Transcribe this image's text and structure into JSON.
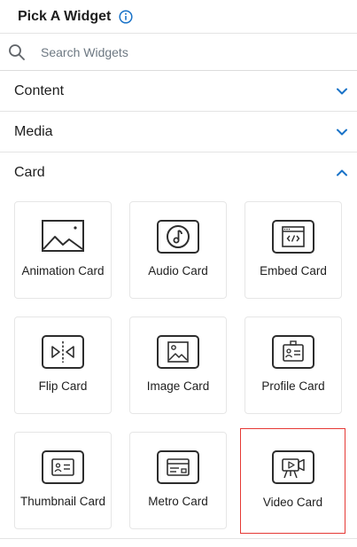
{
  "header": {
    "title": "Pick A Widget",
    "info_icon": "info-icon"
  },
  "search": {
    "placeholder": "Search Widgets",
    "value": "",
    "icon": "search-icon"
  },
  "sections": [
    {
      "label": "Content",
      "expanded": false
    },
    {
      "label": "Media",
      "expanded": false
    },
    {
      "label": "Card",
      "expanded": true
    }
  ],
  "cards": [
    {
      "label": "Animation Card",
      "icon": "image-landscape-icon"
    },
    {
      "label": "Audio Card",
      "icon": "music-note-icon"
    },
    {
      "label": "Embed Card",
      "icon": "code-window-icon"
    },
    {
      "label": "Flip Card",
      "icon": "flip-icon"
    },
    {
      "label": "Image Card",
      "icon": "image-icon"
    },
    {
      "label": "Profile Card",
      "icon": "id-card-icon"
    },
    {
      "label": "Thumbnail Card",
      "icon": "thumbnail-card-icon"
    },
    {
      "label": "Metro Card",
      "icon": "metro-card-icon"
    },
    {
      "label": "Video Card",
      "icon": "video-camera-icon",
      "selected": true
    }
  ],
  "colors": {
    "accent": "#1a73c8",
    "selected_border": "#e53935",
    "icon_stroke": "#2d2d2d"
  }
}
